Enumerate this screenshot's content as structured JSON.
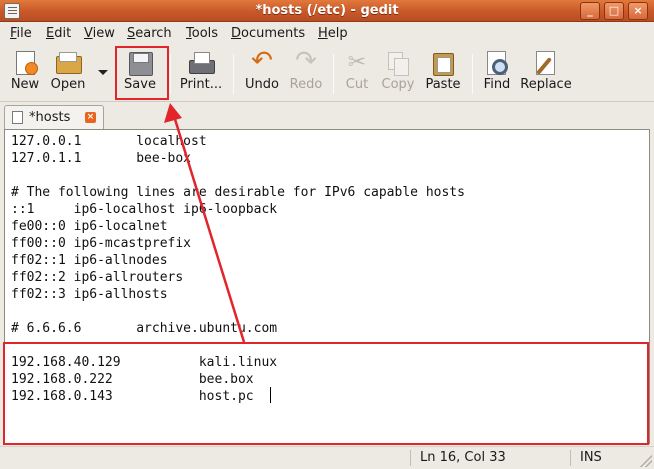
{
  "window": {
    "title": "*hosts (/etc) - gedit",
    "minimize_symbol": "_",
    "maximize_symbol": "□",
    "close_symbol": "×"
  },
  "menu": {
    "file": {
      "first": "F",
      "rest": "ile"
    },
    "edit": {
      "first": "E",
      "rest": "dit"
    },
    "view": {
      "first": "V",
      "rest": "iew"
    },
    "search": {
      "first": "S",
      "rest": "earch"
    },
    "tools": {
      "first": "T",
      "rest": "ools"
    },
    "documents": {
      "first": "D",
      "rest": "ocuments"
    },
    "help": {
      "first": "H",
      "rest": "elp"
    }
  },
  "toolbar": {
    "new": "New",
    "open": "Open",
    "save": "Save",
    "print": "Print...",
    "undo": "Undo",
    "redo": "Redo",
    "cut": "Cut",
    "copy": "Copy",
    "paste": "Paste",
    "find": "Find",
    "replace": "Replace"
  },
  "tab": {
    "label": "*hosts",
    "close_symbol": "×"
  },
  "editor": {
    "lines": [
      "127.0.0.1       localhost",
      "127.0.1.1       bee-box",
      "",
      "# The following lines are desirable for IPv6 capable hosts",
      "::1     ip6-localhost ip6-loopback",
      "fe00::0 ip6-localnet",
      "ff00::0 ip6-mcastprefix",
      "ff02::1 ip6-allnodes",
      "ff02::2 ip6-allrouters",
      "ff02::3 ip6-allhosts",
      "",
      "# 6.6.6.6       archive.ubuntu.com",
      "",
      "192.168.40.129          kali.linux",
      "192.168.0.222           bee.box",
      "192.168.0.143           host.pc "
    ]
  },
  "status": {
    "position": "Ln 16, Col 33",
    "mode": "INS"
  },
  "annotations": {
    "color": "#e1252a"
  },
  "colors": {
    "titlebar": "#c9582a",
    "accent_orange": "#e8651f"
  }
}
